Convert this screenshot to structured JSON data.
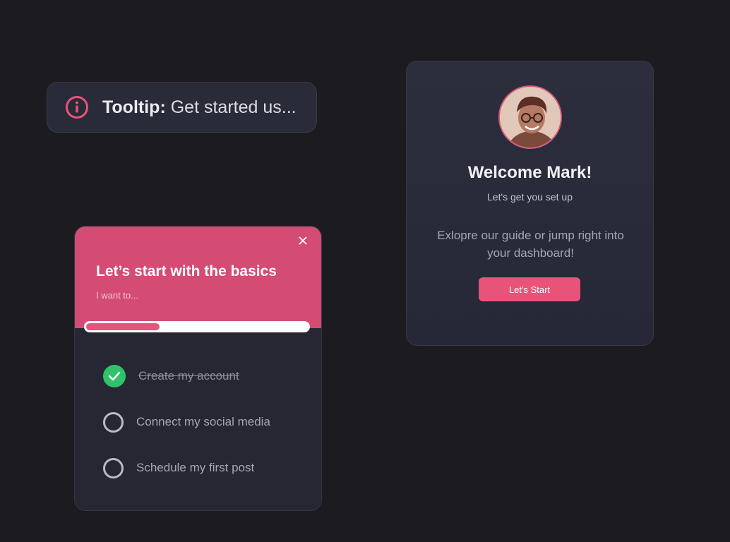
{
  "tooltip": {
    "icon": "info-icon",
    "label": "Tooltip:",
    "text": "Get started us..."
  },
  "welcome": {
    "avatar": "avatar-mark",
    "title": "Welcome Mark!",
    "subtitle": "Let's get you set up",
    "description": "Exlopre our guide or jump right into your dashboard!",
    "button_label": "Let's Start"
  },
  "basics": {
    "close_icon": "close-icon",
    "title": "Let’s start with the basics",
    "subtitle": "I want to...",
    "progress": 0.33,
    "tasks": [
      {
        "label": "Create my account",
        "done": true
      },
      {
        "label": "Connect my social media",
        "done": false
      },
      {
        "label": "Schedule my first post",
        "done": false
      }
    ]
  },
  "colors": {
    "background": "#1c1b20",
    "card": "#262733",
    "accent": "#e8537a",
    "success": "#2fc26b"
  }
}
